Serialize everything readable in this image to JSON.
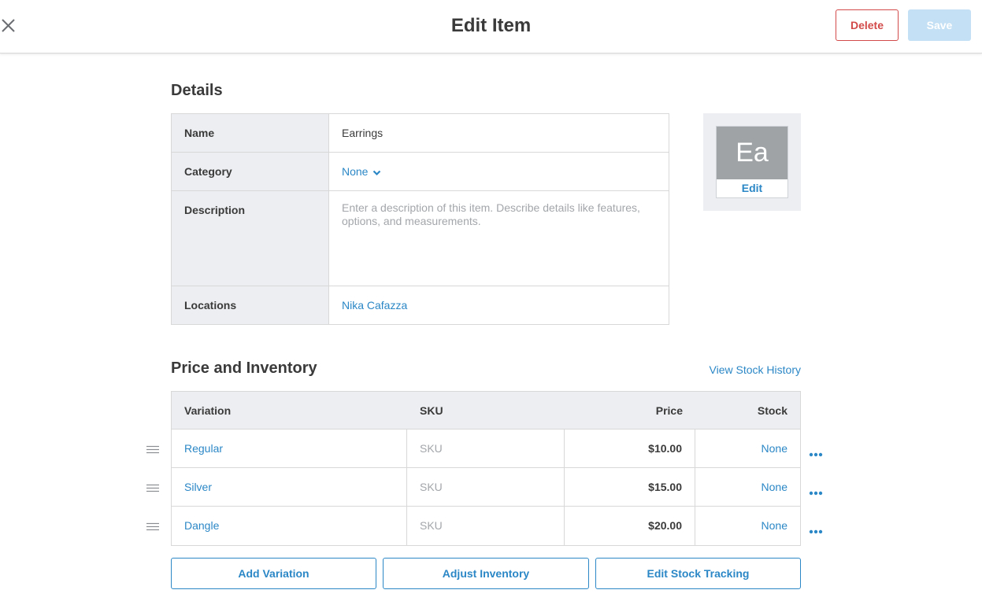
{
  "header": {
    "title": "Edit Item",
    "delete_label": "Delete",
    "save_label": "Save"
  },
  "details": {
    "section_title": "Details",
    "name_label": "Name",
    "name_value": "Earrings",
    "category_label": "Category",
    "category_value": "None",
    "description_label": "Description",
    "description_placeholder": "Enter a description of this item. Describe details like features, options, and measurements.",
    "locations_label": "Locations",
    "locations_value": "Nika Cafazza",
    "thumbnail_initials": "Ea",
    "thumbnail_edit_label": "Edit"
  },
  "price_inventory": {
    "section_title": "Price and Inventory",
    "view_history_label": "View Stock History",
    "columns": [
      "Variation",
      "SKU",
      "Price",
      "Stock"
    ],
    "rows": [
      {
        "variation": "Regular",
        "sku": "SKU",
        "price": "$10.00",
        "stock": "None"
      },
      {
        "variation": "Silver",
        "sku": "SKU",
        "price": "$15.00",
        "stock": "None"
      },
      {
        "variation": "Dangle",
        "sku": "SKU",
        "price": "$20.00",
        "stock": "None"
      }
    ],
    "add_variation_label": "Add Variation",
    "adjust_inventory_label": "Adjust Inventory",
    "edit_stock_tracking_label": "Edit Stock Tracking"
  },
  "icons": {
    "close": "close-icon",
    "category_dropdown": "chevron-down-icon",
    "drag_handle": "drag-handle-icon",
    "row_menu": "more-horizontal-icon"
  },
  "colors": {
    "accent": "#2b87c6",
    "danger": "#d34a4a",
    "save_disabled": "#c4e0f4",
    "label_background": "#eceef1",
    "thumbnail_background": "#a0a3a6"
  }
}
